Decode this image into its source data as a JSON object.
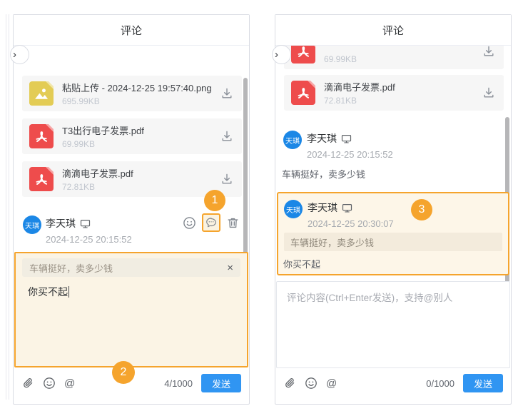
{
  "colors": {
    "annotation_orange": "#F5A42D",
    "avatar_blue": "#1B87E6",
    "send_blue": "#3095F2",
    "pdf_red": "#EE4C4C",
    "image_yellow": "#E3CC55"
  },
  "left_panel": {
    "title": "评论",
    "collapse_chevron": "›",
    "files": [
      {
        "name": "粘贴上传 - 2024-12-25 19:57:40.png",
        "size": "695.99KB",
        "type": "image"
      },
      {
        "name": "T3出行电子发票.pdf",
        "size": "69.99KB",
        "type": "pdf"
      },
      {
        "name": "滴滴电子发票.pdf",
        "size": "72.81KB",
        "type": "pdf"
      }
    ],
    "comment": {
      "avatar": "天琪",
      "name": "李天琪",
      "date": "2024-12-25 20:15:52"
    },
    "compose": {
      "quote": "车辆挺好，卖多少钱",
      "close_label": "×",
      "text": "你买不起",
      "counter": "4/1000",
      "send_label": "发送",
      "at_label": "@"
    }
  },
  "right_panel": {
    "title": "评论",
    "collapse_chevron": "›",
    "files": [
      {
        "name": "",
        "size": "69.99KB",
        "type": "pdf"
      },
      {
        "name": "滴滴电子发票.pdf",
        "size": "72.81KB",
        "type": "pdf"
      }
    ],
    "comments": [
      {
        "avatar": "天琪",
        "name": "李天琪",
        "date": "2024-12-25 20:15:52",
        "text": "车辆挺好，卖多少钱"
      },
      {
        "avatar": "天琪",
        "name": "李天琪",
        "date": "2024-12-25 20:30:07",
        "quote": "车辆挺好，卖多少钱",
        "text": "你买不起"
      }
    ],
    "compose": {
      "placeholder": "评论内容(Ctrl+Enter发送)，支持@别人",
      "counter": "0/1000",
      "send_label": "发送",
      "at_label": "@"
    }
  },
  "annotations": {
    "step1": "1",
    "step2": "2",
    "step3": "3"
  }
}
